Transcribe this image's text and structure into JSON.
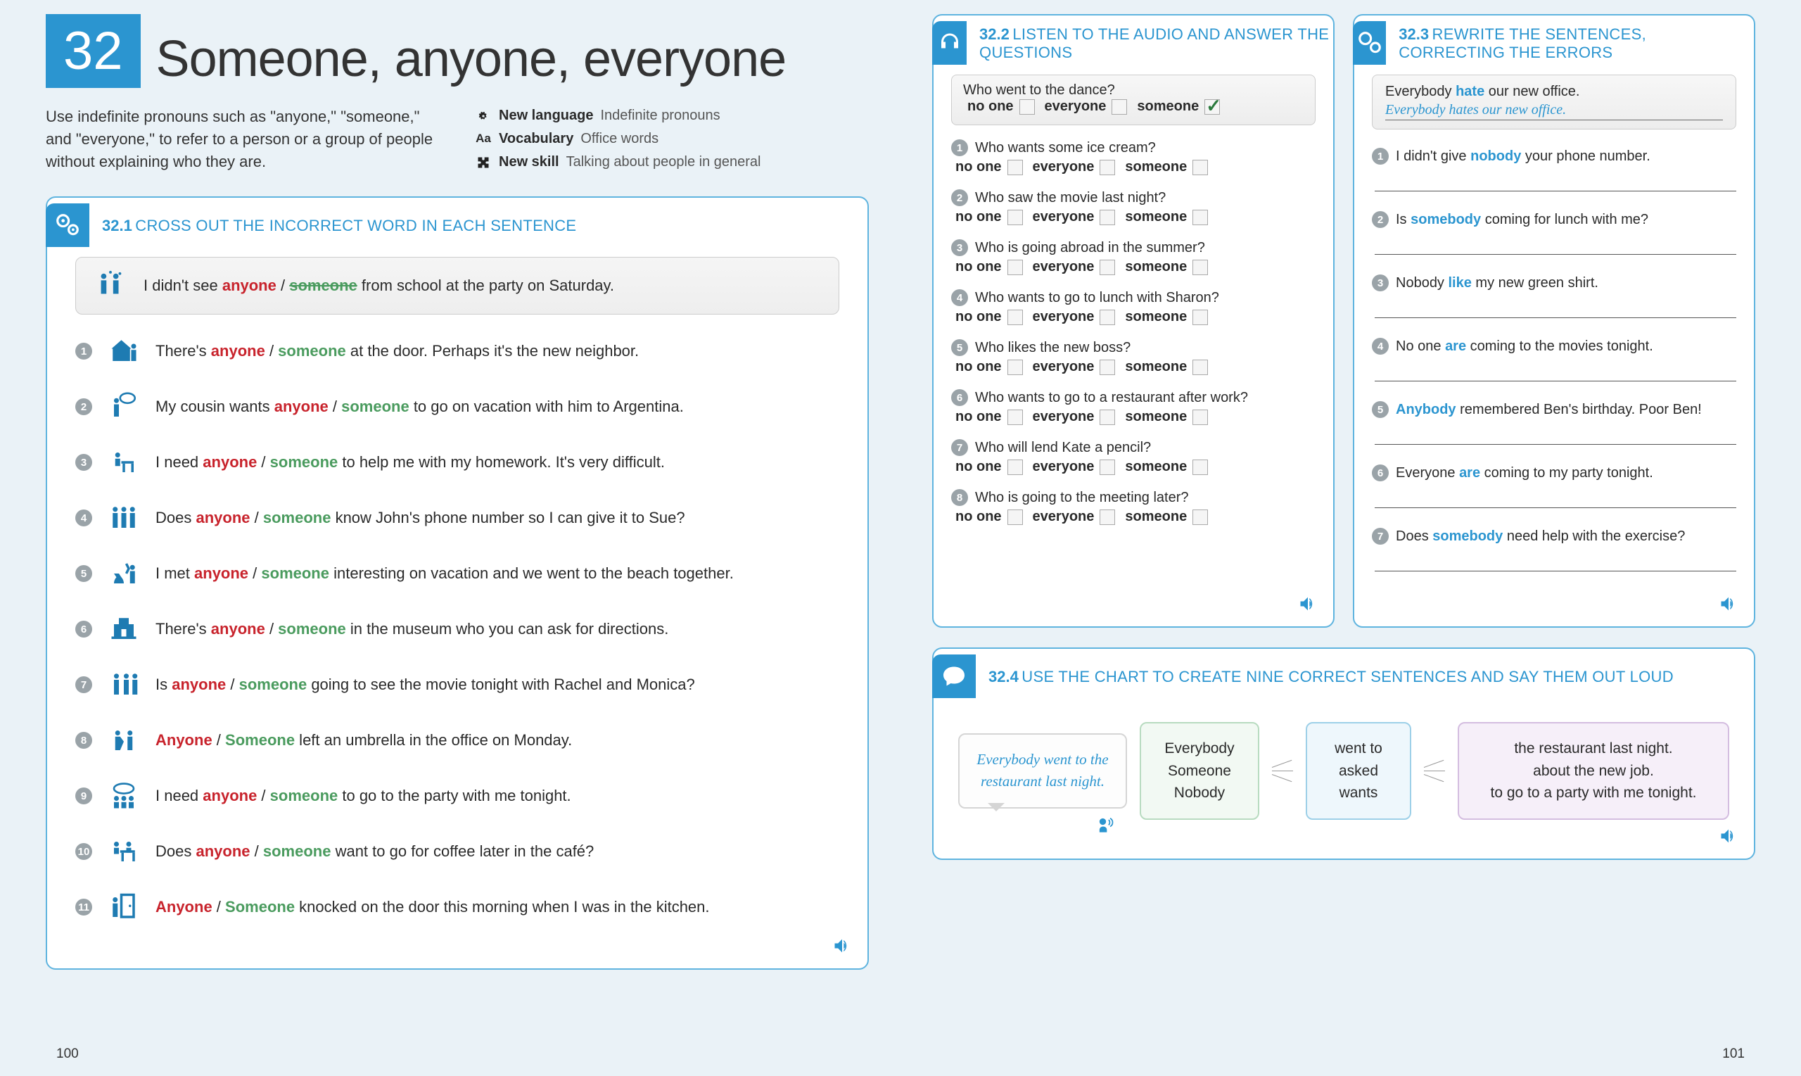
{
  "chapter": {
    "number": "32",
    "title": "Someone, anyone, everyone"
  },
  "intro": "Use indefinite pronouns such as \"anyone,\" \"someone,\" and \"everyone,\" to refer to a person or a group of people without explaining who they are.",
  "info": {
    "new_language": {
      "label": "New language",
      "detail": "Indefinite pronouns"
    },
    "vocabulary": {
      "label": "Vocabulary",
      "detail": "Office words"
    },
    "new_skill": {
      "label": "New skill",
      "detail": "Talking about people in general"
    }
  },
  "ex1": {
    "num": "32.1",
    "title": "CROSS OUT THE INCORRECT WORD IN EACH SENTENCE",
    "example": {
      "pre": "I didn't see ",
      "w1": "anyone",
      "sep": " / ",
      "w2": "someone",
      "post": " from school at the party on Saturday."
    },
    "items": [
      {
        "pre": "There's ",
        "w1": "anyone",
        "sep": " / ",
        "w2": "someone",
        "post": " at the door. Perhaps it's the new neighbor."
      },
      {
        "pre": "My cousin wants ",
        "w1": "anyone",
        "sep": " / ",
        "w2": "someone",
        "post": " to go on vacation with him to Argentina."
      },
      {
        "pre": "I need ",
        "w1": "anyone",
        "sep": " / ",
        "w2": "someone",
        "post": " to help me with my homework. It's very difficult."
      },
      {
        "pre": "Does ",
        "w1": "anyone",
        "sep": " / ",
        "w2": "someone",
        "post": " know John's phone number so I can give it to Sue?"
      },
      {
        "pre": "I met ",
        "w1": "anyone",
        "sep": " / ",
        "w2": "someone",
        "post": " interesting on vacation and we went to the beach together."
      },
      {
        "pre": "There's ",
        "w1": "anyone",
        "sep": " / ",
        "w2": "someone",
        "post": " in the museum who you can ask for directions."
      },
      {
        "pre": "Is ",
        "w1": "anyone",
        "sep": " / ",
        "w2": "someone",
        "post": " going to see the movie tonight with Rachel and Monica?"
      },
      {
        "pre": "",
        "w1": "Anyone",
        "sep": " / ",
        "w2": "Someone",
        "post": " left an umbrella in the office on Monday."
      },
      {
        "pre": "I need ",
        "w1": "anyone",
        "sep": " / ",
        "w2": "someone",
        "post": " to go to the party with me tonight."
      },
      {
        "pre": "Does ",
        "w1": "anyone",
        "sep": " / ",
        "w2": "someone",
        "post": " want to go for coffee later in the café?"
      },
      {
        "pre": "",
        "w1": "Anyone",
        "sep": " / ",
        "w2": "Someone",
        "post": " knocked on the door this morning when I was in the kitchen."
      }
    ]
  },
  "ex2": {
    "num": "32.2",
    "title": "LISTEN TO THE AUDIO AND ANSWER THE QUESTIONS",
    "opts": {
      "a": "no one",
      "b": "everyone",
      "c": "someone"
    },
    "example": {
      "q": "Who went to the dance?",
      "checked": "c"
    },
    "items": [
      "Who wants some ice cream?",
      "Who saw the movie last night?",
      "Who is going abroad in the summer?",
      "Who wants to go to lunch with Sharon?",
      "Who likes the new boss?",
      "Who wants to go to a restaurant after work?",
      "Who will lend Kate a pencil?",
      "Who is going to the meeting later?"
    ]
  },
  "ex3": {
    "num": "32.3",
    "title": "REWRITE THE SENTENCES, CORRECTING THE ERRORS",
    "example": {
      "q_pre": "Everybody ",
      "q_hl": "hate",
      "q_post": " our new office.",
      "answer": "Everybody hates our new office."
    },
    "items": [
      {
        "pre": "I didn't give ",
        "hl": "nobody",
        "post": " your phone number."
      },
      {
        "pre": "Is ",
        "hl": "somebody",
        "post": " coming for lunch with me?"
      },
      {
        "pre": "Nobody ",
        "hl": "like",
        "post": " my new green shirt."
      },
      {
        "pre": "No one ",
        "hl": "are",
        "post": " coming to the movies tonight."
      },
      {
        "pre": "",
        "hl": "Anybody",
        "post": " remembered Ben's birthday. Poor Ben!"
      },
      {
        "pre": "Everyone ",
        "hl": "are",
        "post": " coming to my party tonight."
      },
      {
        "pre": "Does ",
        "hl": "somebody",
        "post": " need help with the exercise?"
      }
    ]
  },
  "ex4": {
    "num": "32.4",
    "title": "USE THE CHART TO CREATE NINE CORRECT SENTENCES AND SAY THEM OUT LOUD",
    "example": "Everybody went to the restaurant last night.",
    "col1": [
      "Everybody",
      "Someone",
      "Nobody"
    ],
    "col2": [
      "went to",
      "asked",
      "wants"
    ],
    "col3": [
      "the restaurant last night.",
      "about the new job.",
      "to go to a party with me tonight."
    ]
  },
  "pages": {
    "left": "100",
    "right": "101"
  }
}
